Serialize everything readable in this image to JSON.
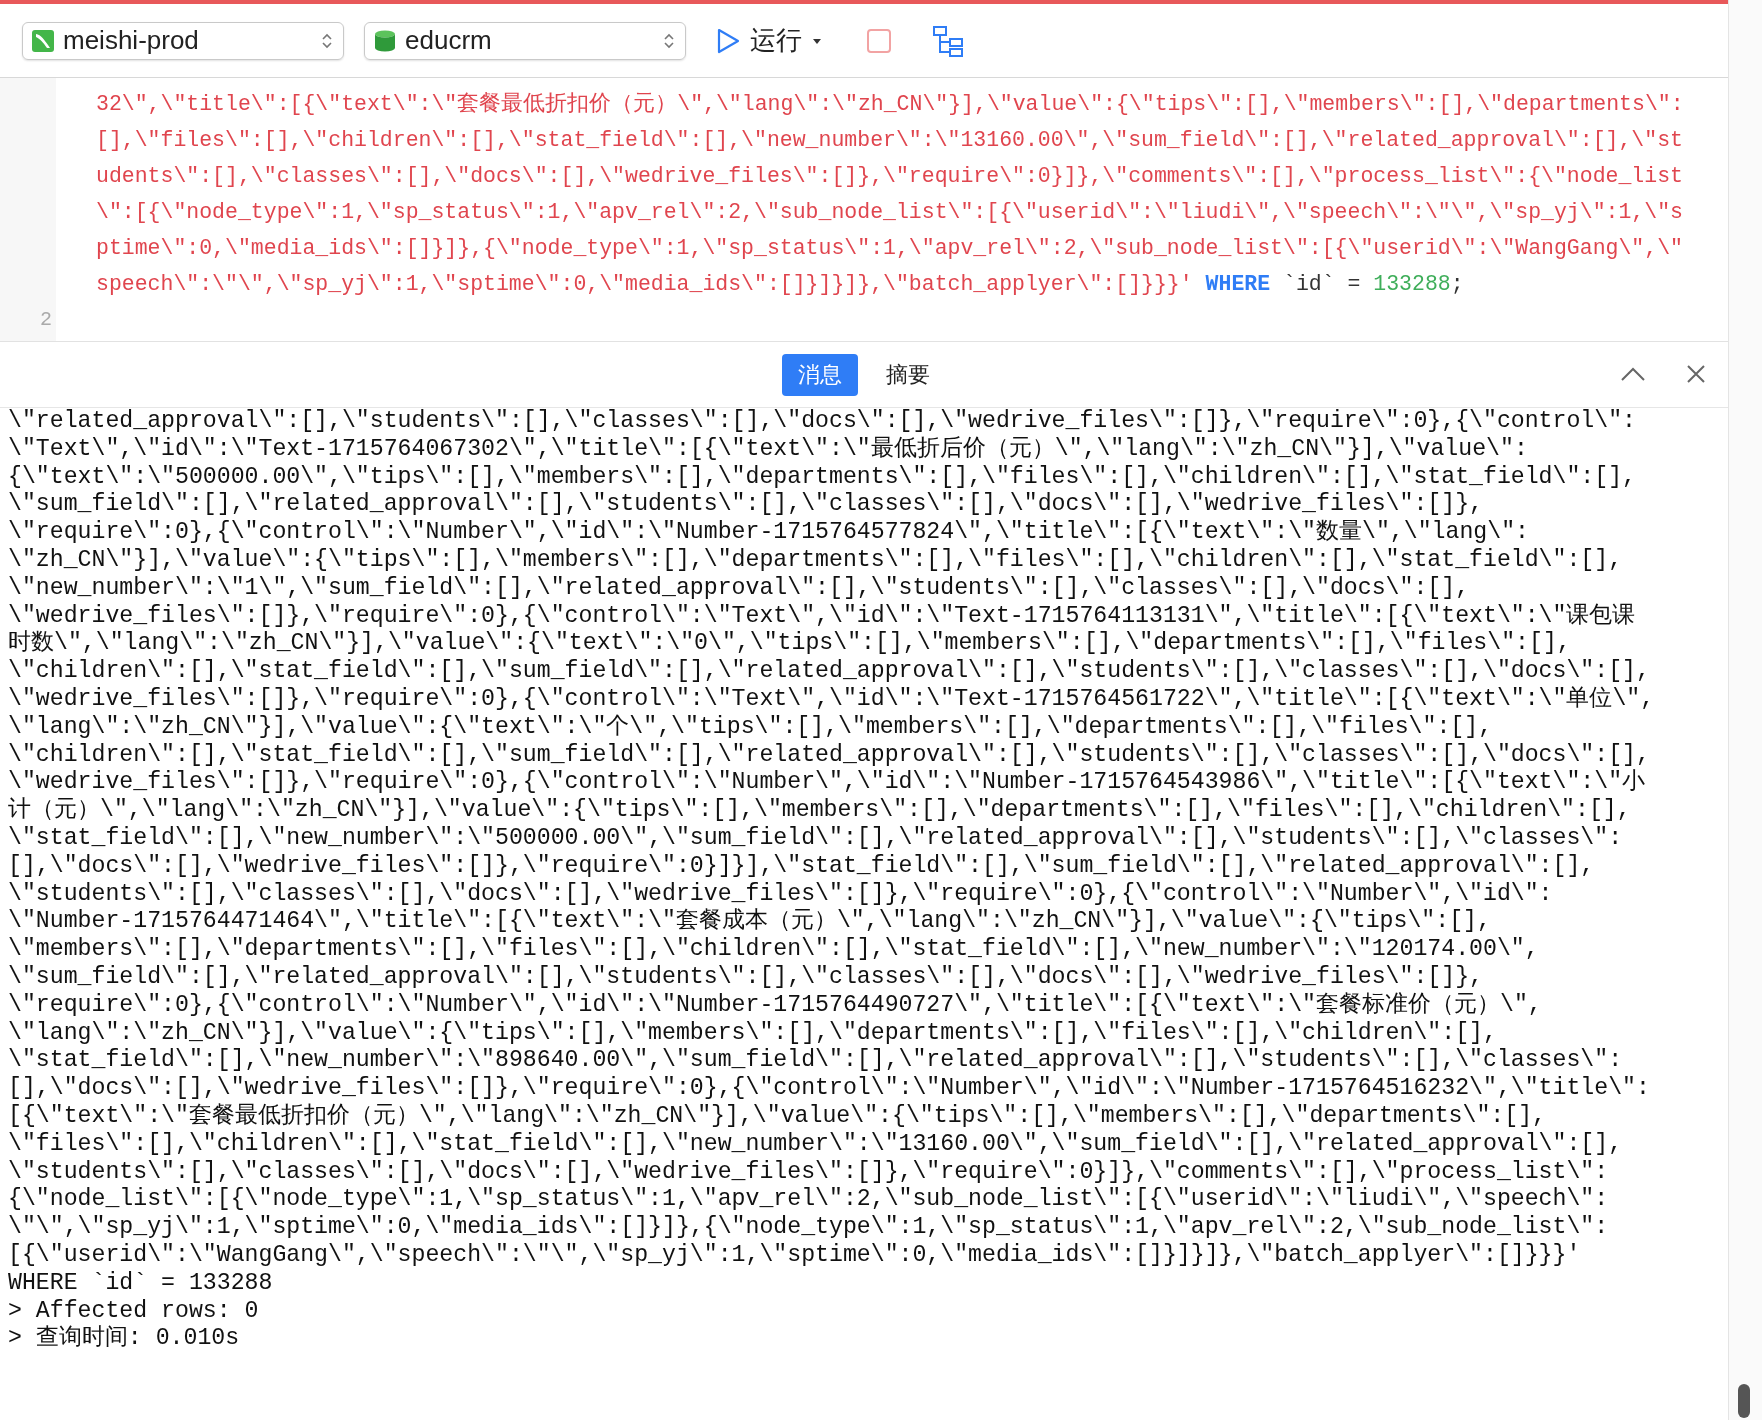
{
  "toolbar": {
    "connection": "meishi-prod",
    "database": "educrm",
    "run_label": "运行"
  },
  "editor": {
    "rows": [
      {
        "tokens": [
          {
            "kind": "string",
            "text": "32\\\",\\\"title\\\":[{\\\"text\\\":\\\"套餐最低折扣价（元）\\\",\\\"lang\\\":\\\"zh_CN\\\"}],\\\"value\\\":{\\\"tips\\\":[],\\\"members\\\":[],\\\"departments\\\":"
          }
        ]
      },
      {
        "tokens": [
          {
            "kind": "string",
            "text": "[],\\\"files\\\":[],\\\"children\\\":[],\\\"stat_field\\\":[],\\\"new_number\\\":\\\"13160.00\\\",\\\"sum_field\\\":[],\\\"related_approval\\\":[],\\\"st"
          }
        ]
      },
      {
        "tokens": [
          {
            "kind": "string",
            "text": "udents\\\":[],\\\"classes\\\":[],\\\"docs\\\":[],\\\"wedrive_files\\\":[]},\\\"require\\\":0}]},\\\"comments\\\":[],\\\"process_list\\\":{\\\"node_list"
          }
        ]
      },
      {
        "tokens": [
          {
            "kind": "string",
            "text": "\\\":[{\\\"node_type\\\":1,\\\"sp_status\\\":1,\\\"apv_rel\\\":2,\\\"sub_node_list\\\":[{\\\"userid\\\":\\\"liudi\\\",\\\"speech\\\":\\\"\\\",\\\"sp_yj\\\":1,\\\"s"
          }
        ]
      },
      {
        "tokens": [
          {
            "kind": "string",
            "text": "ptime\\\":0,\\\"media_ids\\\":[]}]},{\\\"node_type\\\":1,\\\"sp_status\\\":1,\\\"apv_rel\\\":2,\\\"sub_node_list\\\":[{\\\"userid\\\":\\\"WangGang\\\",\\\""
          }
        ]
      },
      {
        "tokens": [
          {
            "kind": "string",
            "text": "speech\\\":\\\"\\\",\\\"sp_yj\\\":1,\\\"sptime\\\":0,\\\"media_ids\\\":[]}]}]},\\\"batch_applyer\\\":[]}}}'"
          },
          {
            "kind": "keyword",
            "text": "WHERE"
          },
          {
            "kind": "plain",
            "text": "`id`"
          },
          {
            "kind": "plain",
            "text": "="
          },
          {
            "kind": "number",
            "text": "133288"
          },
          {
            "kind": "plain",
            "text": ";"
          }
        ]
      },
      {
        "number": "2",
        "tokens": []
      }
    ]
  },
  "tabs": [
    {
      "label": "消息",
      "selected": true
    },
    {
      "label": "摘要",
      "selected": false
    }
  ],
  "messages": [
    "\\\"related_approval\\\":[],\\\"students\\\":[],\\\"classes\\\":[],\\\"docs\\\":[],\\\"wedrive_files\\\":[]},\\\"require\\\":0},{\\\"control\\\":",
    "\\\"Text\\\",\\\"id\\\":\\\"Text-1715764067302\\\",\\\"title\\\":[{\\\"text\\\":\\\"最低折后价（元）\\\",\\\"lang\\\":\\\"zh_CN\\\"}],\\\"value\\\":",
    "{\\\"text\\\":\\\"500000.00\\\",\\\"tips\\\":[],\\\"members\\\":[],\\\"departments\\\":[],\\\"files\\\":[],\\\"children\\\":[],\\\"stat_field\\\":[],",
    "\\\"sum_field\\\":[],\\\"related_approval\\\":[],\\\"students\\\":[],\\\"classes\\\":[],\\\"docs\\\":[],\\\"wedrive_files\\\":[]},",
    "\\\"require\\\":0},{\\\"control\\\":\\\"Number\\\",\\\"id\\\":\\\"Number-1715764577824\\\",\\\"title\\\":[{\\\"text\\\":\\\"数量\\\",\\\"lang\\\":",
    "\\\"zh_CN\\\"}],\\\"value\\\":{\\\"tips\\\":[],\\\"members\\\":[],\\\"departments\\\":[],\\\"files\\\":[],\\\"children\\\":[],\\\"stat_field\\\":[],",
    "\\\"new_number\\\":\\\"1\\\",\\\"sum_field\\\":[],\\\"related_approval\\\":[],\\\"students\\\":[],\\\"classes\\\":[],\\\"docs\\\":[],",
    "\\\"wedrive_files\\\":[]},\\\"require\\\":0},{\\\"control\\\":\\\"Text\\\",\\\"id\\\":\\\"Text-1715764113131\\\",\\\"title\\\":[{\\\"text\\\":\\\"课包课",
    "时数\\\",\\\"lang\\\":\\\"zh_CN\\\"}],\\\"value\\\":{\\\"text\\\":\\\"0\\\",\\\"tips\\\":[],\\\"members\\\":[],\\\"departments\\\":[],\\\"files\\\":[],",
    "\\\"children\\\":[],\\\"stat_field\\\":[],\\\"sum_field\\\":[],\\\"related_approval\\\":[],\\\"students\\\":[],\\\"classes\\\":[],\\\"docs\\\":[],",
    "\\\"wedrive_files\\\":[]},\\\"require\\\":0},{\\\"control\\\":\\\"Text\\\",\\\"id\\\":\\\"Text-1715764561722\\\",\\\"title\\\":[{\\\"text\\\":\\\"单位\\\",",
    "\\\"lang\\\":\\\"zh_CN\\\"}],\\\"value\\\":{\\\"text\\\":\\\"个\\\",\\\"tips\\\":[],\\\"members\\\":[],\\\"departments\\\":[],\\\"files\\\":[],",
    "\\\"children\\\":[],\\\"stat_field\\\":[],\\\"sum_field\\\":[],\\\"related_approval\\\":[],\\\"students\\\":[],\\\"classes\\\":[],\\\"docs\\\":[],",
    "\\\"wedrive_files\\\":[]},\\\"require\\\":0},{\\\"control\\\":\\\"Number\\\",\\\"id\\\":\\\"Number-1715764543986\\\",\\\"title\\\":[{\\\"text\\\":\\\"小",
    "计（元）\\\",\\\"lang\\\":\\\"zh_CN\\\"}],\\\"value\\\":{\\\"tips\\\":[],\\\"members\\\":[],\\\"departments\\\":[],\\\"files\\\":[],\\\"children\\\":[],",
    "\\\"stat_field\\\":[],\\\"new_number\\\":\\\"500000.00\\\",\\\"sum_field\\\":[],\\\"related_approval\\\":[],\\\"students\\\":[],\\\"classes\\\":",
    "[],\\\"docs\\\":[],\\\"wedrive_files\\\":[]},\\\"require\\\":0}]}],\\\"stat_field\\\":[],\\\"sum_field\\\":[],\\\"related_approval\\\":[],",
    "\\\"students\\\":[],\\\"classes\\\":[],\\\"docs\\\":[],\\\"wedrive_files\\\":[]},\\\"require\\\":0},{\\\"control\\\":\\\"Number\\\",\\\"id\\\":",
    "\\\"Number-1715764471464\\\",\\\"title\\\":[{\\\"text\\\":\\\"套餐成本（元）\\\",\\\"lang\\\":\\\"zh_CN\\\"}],\\\"value\\\":{\\\"tips\\\":[],",
    "\\\"members\\\":[],\\\"departments\\\":[],\\\"files\\\":[],\\\"children\\\":[],\\\"stat_field\\\":[],\\\"new_number\\\":\\\"120174.00\\\",",
    "\\\"sum_field\\\":[],\\\"related_approval\\\":[],\\\"students\\\":[],\\\"classes\\\":[],\\\"docs\\\":[],\\\"wedrive_files\\\":[]},",
    "\\\"require\\\":0},{\\\"control\\\":\\\"Number\\\",\\\"id\\\":\\\"Number-1715764490727\\\",\\\"title\\\":[{\\\"text\\\":\\\"套餐标准价（元）\\\",",
    "\\\"lang\\\":\\\"zh_CN\\\"}],\\\"value\\\":{\\\"tips\\\":[],\\\"members\\\":[],\\\"departments\\\":[],\\\"files\\\":[],\\\"children\\\":[],",
    "\\\"stat_field\\\":[],\\\"new_number\\\":\\\"898640.00\\\",\\\"sum_field\\\":[],\\\"related_approval\\\":[],\\\"students\\\":[],\\\"classes\\\":",
    "[],\\\"docs\\\":[],\\\"wedrive_files\\\":[]},\\\"require\\\":0},{\\\"control\\\":\\\"Number\\\",\\\"id\\\":\\\"Number-1715764516232\\\",\\\"title\\\":",
    "[{\\\"text\\\":\\\"套餐最低折扣价（元）\\\",\\\"lang\\\":\\\"zh_CN\\\"}],\\\"value\\\":{\\\"tips\\\":[],\\\"members\\\":[],\\\"departments\\\":[],",
    "\\\"files\\\":[],\\\"children\\\":[],\\\"stat_field\\\":[],\\\"new_number\\\":\\\"13160.00\\\",\\\"sum_field\\\":[],\\\"related_approval\\\":[],",
    "\\\"students\\\":[],\\\"classes\\\":[],\\\"docs\\\":[],\\\"wedrive_files\\\":[]},\\\"require\\\":0}]},\\\"comments\\\":[],\\\"process_list\\\":",
    "{\\\"node_list\\\":[{\\\"node_type\\\":1,\\\"sp_status\\\":1,\\\"apv_rel\\\":2,\\\"sub_node_list\\\":[{\\\"userid\\\":\\\"liudi\\\",\\\"speech\\\":",
    "\\\"\\\",\\\"sp_yj\\\":1,\\\"sptime\\\":0,\\\"media_ids\\\":[]}]},{\\\"node_type\\\":1,\\\"sp_status\\\":1,\\\"apv_rel\\\":2,\\\"sub_node_list\\\":",
    "[{\\\"userid\\\":\\\"WangGang\\\",\\\"speech\\\":\\\"\\\",\\\"sp_yj\\\":1,\\\"sptime\\\":0,\\\"media_ids\\\":[]}]}]},\\\"batch_applyer\\\":[]}}}'",
    "WHERE `id` = 133288",
    "> Affected rows: 0",
    "> 查询时间: 0.010s"
  ]
}
